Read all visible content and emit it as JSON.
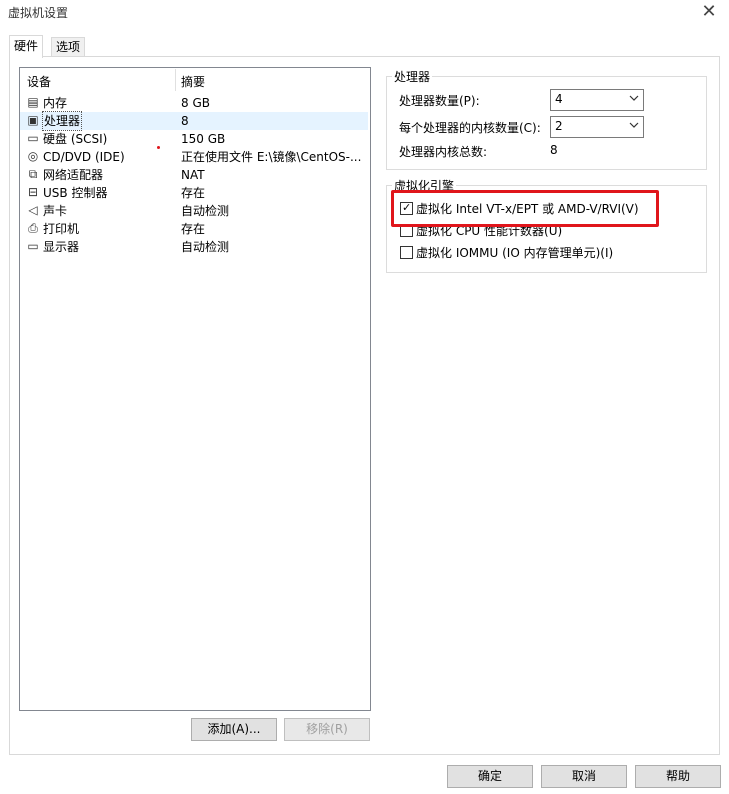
{
  "window": {
    "title": "虚拟机设置",
    "close_glyph": "✕"
  },
  "tabs": [
    {
      "label": "硬件",
      "active": true
    },
    {
      "label": "选项",
      "active": false
    }
  ],
  "device_list": {
    "headers": {
      "device": "设备",
      "summary": "摘要"
    },
    "rows": [
      {
        "name": "内存",
        "summary": "8 GB",
        "icon": "memory-icon",
        "glyph": "▤"
      },
      {
        "name": "处理器",
        "summary": "8",
        "icon": "processor-icon",
        "glyph": "▣",
        "selected": true
      },
      {
        "name": "硬盘 (SCSI)",
        "summary": "150 GB",
        "icon": "hard-disk-icon",
        "glyph": "▭"
      },
      {
        "name": "CD/DVD (IDE)",
        "summary": "正在使用文件 E:\\镜像\\CentOS-...",
        "icon": "cd-dvd-icon",
        "glyph": "◎"
      },
      {
        "name": "网络适配器",
        "summary": "NAT",
        "icon": "network-adapter-icon",
        "glyph": "⧉"
      },
      {
        "name": "USB 控制器",
        "summary": "存在",
        "icon": "usb-controller-icon",
        "glyph": "⊟"
      },
      {
        "name": "声卡",
        "summary": "自动检测",
        "icon": "sound-card-icon",
        "glyph": "◁"
      },
      {
        "name": "打印机",
        "summary": "存在",
        "icon": "printer-icon",
        "glyph": "⎙"
      },
      {
        "name": "显示器",
        "summary": "自动检测",
        "icon": "display-icon",
        "glyph": "▭"
      }
    ]
  },
  "buttons": {
    "add": "添加(A)...",
    "remove": "移除(R)",
    "ok": "确定",
    "cancel": "取消",
    "help": "帮助"
  },
  "processor": {
    "group_label": "处理器",
    "count_label": "处理器数量(P):",
    "count_value": "4",
    "cores_label": "每个处理器的内核数量(C):",
    "cores_value": "2",
    "total_label": "处理器内核总数:",
    "total_value": "8"
  },
  "virtualization": {
    "group_label": "虚拟化引擎",
    "options": [
      {
        "label": "虚拟化 Intel VT-x/EPT 或 AMD-V/RVI(V)",
        "checked": true
      },
      {
        "label": "虚拟化 CPU 性能计数器(U)",
        "checked": false
      },
      {
        "label": "虚拟化 IOMMU (IO 内存管理单元)(I)",
        "checked": false
      }
    ]
  },
  "colors": {
    "highlight_red": "#e0151b",
    "selection": "#e5f3ff"
  }
}
